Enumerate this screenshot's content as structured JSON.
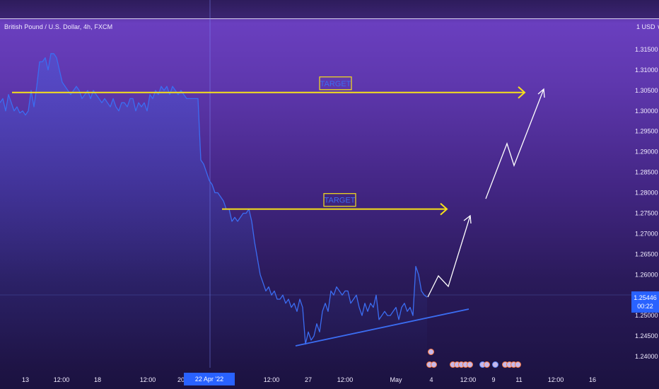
{
  "chart": {
    "symbol_title": "British Pound / U.S. Dollar, 4h, FXCM",
    "currency_label": "1 USD ∨",
    "last_price": "1.25446",
    "countdown": "00:22",
    "crosshair_date": "22 Apr '22",
    "colors": {
      "price_line": "#3b6df2",
      "target_line": "#f7e11a",
      "projection": "#ffffff",
      "label_bg": "#2962ff"
    },
    "targets": [
      {
        "label": "TARGET",
        "price": 1.3045
      },
      {
        "label": "TARGET",
        "price": 1.276
      }
    ]
  },
  "chart_data": {
    "type": "line",
    "title": "British Pound / U.S. Dollar, 4h, FXCM",
    "ylim": [
      1.2355,
      1.3235
    ],
    "y_ticks": [
      "1.31500",
      "1.31000",
      "1.30500",
      "1.30000",
      "1.29500",
      "1.29000",
      "1.28500",
      "1.28000",
      "1.27500",
      "1.27000",
      "1.26500",
      "1.26000",
      "1.25500",
      "1.25000",
      "1.24500",
      "1.24000"
    ],
    "x_ticks": [
      "13",
      "12:00",
      "18",
      "12:00",
      "20",
      "12:",
      "12:00",
      "27",
      "12:00",
      "May",
      "4",
      "12:00",
      "9",
      "11",
      "12:00",
      "16"
    ],
    "series": [
      {
        "x": [
          0,
          4,
          8,
          12,
          16,
          20,
          24,
          28,
          32,
          36,
          40,
          44,
          48,
          52,
          56,
          60,
          64,
          68,
          72,
          76,
          80,
          84,
          88,
          92,
          96,
          100,
          104,
          108,
          112,
          116,
          120,
          124,
          128,
          132,
          136,
          140,
          144,
          148,
          152,
          156,
          160,
          164,
          168,
          172,
          176,
          180,
          184,
          188,
          192,
          196,
          200,
          204,
          208,
          212,
          216,
          220,
          224,
          228,
          232,
          236,
          240,
          244,
          248,
          252,
          256,
          260,
          264,
          268,
          272,
          276,
          280,
          284,
          288,
          292,
          296,
          300,
          304,
          308,
          312,
          316,
          320,
          324,
          328,
          332,
          336,
          340,
          344,
          348,
          352,
          356,
          360,
          364,
          368,
          372,
          376,
          380,
          384,
          388,
          392,
          396,
          400,
          404,
          408,
          412,
          416,
          420,
          424,
          428,
          432,
          436,
          440,
          444,
          448,
          452,
          456,
          460,
          464,
          468,
          472,
          476,
          480,
          484,
          488,
          492,
          496,
          500,
          504,
          508,
          512,
          516,
          520,
          524,
          528,
          532,
          536,
          540,
          544,
          548,
          552,
          556,
          560,
          564,
          568,
          572,
          576,
          580,
          584,
          588,
          592,
          596,
          600,
          604
        ],
        "values": [
          1.302,
          1.303,
          1.3,
          1.304,
          1.302,
          1.3,
          1.301,
          1.2995,
          1.3,
          1.299,
          1.3,
          1.305,
          1.301,
          1.306,
          1.312,
          1.312,
          1.313,
          1.31,
          1.314,
          1.314,
          1.313,
          1.31,
          1.307,
          1.306,
          1.305,
          1.304,
          1.305,
          1.306,
          1.305,
          1.303,
          1.304,
          1.305,
          1.303,
          1.305,
          1.304,
          1.303,
          1.302,
          1.303,
          1.302,
          1.301,
          1.303,
          1.301,
          1.3,
          1.302,
          1.302,
          1.301,
          1.303,
          1.303,
          1.3,
          1.302,
          1.301,
          1.302,
          1.3,
          1.304,
          1.303,
          1.305,
          1.304,
          1.306,
          1.305,
          1.306,
          1.304,
          1.306,
          1.305,
          1.304,
          1.305,
          1.304,
          1.303,
          1.303,
          1.303,
          1.303,
          1.303,
          1.288,
          1.287,
          1.285,
          1.283,
          1.282,
          1.28,
          1.28,
          1.279,
          1.278,
          1.276,
          1.276,
          1.273,
          1.274,
          1.273,
          1.274,
          1.275,
          1.275,
          1.276,
          1.273,
          1.268,
          1.264,
          1.26,
          1.258,
          1.256,
          1.257,
          1.255,
          1.256,
          1.254,
          1.254,
          1.255,
          1.253,
          1.254,
          1.252,
          1.253,
          1.251,
          1.254,
          1.252,
          1.243,
          1.246,
          1.244,
          1.245,
          1.248,
          1.246,
          1.251,
          1.253,
          1.251,
          1.256,
          1.255,
          1.257,
          1.256,
          1.255,
          1.256,
          1.256,
          1.253,
          1.254,
          1.255,
          1.252,
          1.25,
          1.253,
          1.251,
          1.253,
          1.252,
          1.255,
          1.249,
          1.25,
          1.251,
          1.25,
          1.25,
          1.251,
          1.252,
          1.249,
          1.252,
          1.253,
          1.251,
          1.252,
          1.25,
          1.262,
          1.26,
          1.256,
          1.255,
          1.2545
        ]
      }
    ]
  }
}
